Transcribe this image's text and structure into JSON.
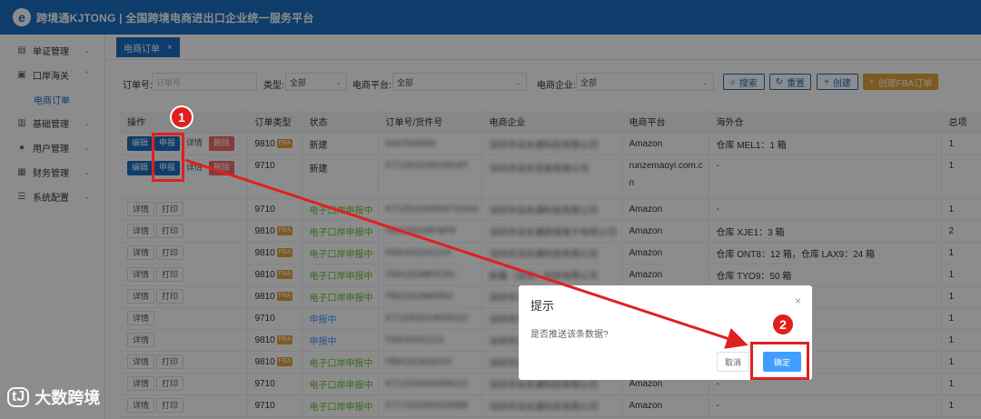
{
  "topbar": {
    "logo": "e",
    "title": "跨境通KJTONG | 全国跨境电商进出口企业统一服务平台"
  },
  "sidebar": {
    "items": [
      {
        "label": "单证管理",
        "icon": "document-icon"
      },
      {
        "label": "口岸海关",
        "icon": "customs-icon"
      },
      {
        "label": "基础管理",
        "icon": "chart-icon"
      },
      {
        "label": "用户管理",
        "icon": "user-icon"
      },
      {
        "label": "财务管理",
        "icon": "finance-icon"
      },
      {
        "label": "系统配置",
        "icon": "list-icon"
      }
    ],
    "subitem": "电商订单"
  },
  "tab": {
    "label": "电商订单",
    "close": "×"
  },
  "filters": {
    "order_no_label": "订单号:",
    "order_no_placeholder": "订单号",
    "type_label": "类型:",
    "type_value": "全部",
    "platform_label": "电商平台:",
    "platform_value": "全部",
    "company_label": "电商企业:",
    "company_value": "全部",
    "search": "搜索",
    "reset": "重置",
    "create": "创建",
    "create_fba": "创建FBA订单"
  },
  "table": {
    "headers": [
      "操作",
      "订单类型",
      "状态",
      "订单号/货件号",
      "电商企业",
      "电商平台",
      "海外仓",
      "总项"
    ],
    "actions": {
      "edit": "编辑",
      "declare": "申报",
      "detail": "详情",
      "delete": "删除",
      "print": "打印"
    },
    "fba_tag": "FBA",
    "rows": [
      {
        "type": "9810",
        "fba": true,
        "status": "新建",
        "order": "5407826000",
        "company": "深圳市深关通科技有限公司",
        "platform": "Amazon",
        "warehouse": "仓库 MEL1：1 箱",
        "total": "1"
      },
      {
        "type": "9710",
        "fba": false,
        "status": "新建",
        "order": "KT1291624019918T",
        "company": "深圳市深关贸易有限公司",
        "platform": "runzemaoyi.com.c",
        "platform2": "n",
        "warehouse": "-",
        "total": "1"
      },
      {
        "type": "9710",
        "fba": false,
        "status": "电子口岸申报中",
        "order": "KT1251532003715244",
        "company": "深圳市深关通科技有限公司",
        "platform": "Amazon",
        "warehouse": "-",
        "total": "1"
      },
      {
        "type": "9810",
        "fba": true,
        "status": "电子口岸申报中",
        "order": "FBA15GZ8FNPR",
        "company": "深圳市深关通跨境电子有限公司",
        "platform": "Amazon",
        "warehouse": "仓库 XJE1：3 箱",
        "total": "2"
      },
      {
        "type": "9810",
        "fba": true,
        "status": "电子口岸申报中",
        "order": "FBA15GZ41124",
        "company": "深圳市深关通科技有限公司",
        "platform": "Amazon",
        "warehouse": "仓库 ONT8：12 箱，仓库 LAX9：24 箱",
        "total": "1"
      },
      {
        "type": "9810",
        "fba": true,
        "status": "电子口岸申报中",
        "order": "FBA15G8BSC6V",
        "company": "新疆（深关）科技有限公司",
        "platform": "Amazon",
        "warehouse": "仓库 TYO9：50 箱",
        "total": "1"
      },
      {
        "type": "9810",
        "fba": true,
        "status": "电子口岸申报中",
        "order": "FBA15G8M0902",
        "company": "深圳市深关通科技有限公司",
        "platform": "Amazon",
        "warehouse": "-",
        "total": "1"
      },
      {
        "type": "9710",
        "fba": false,
        "status": "申报中",
        "order": "KT12303219029122",
        "company": "深圳市深关通科技有限公司",
        "platform": "Amazon",
        "warehouse": "-",
        "total": "1"
      },
      {
        "type": "9810",
        "fba": true,
        "status": "申报中",
        "order": "FBA20251123",
        "company": "深圳市深关通科技有限公司",
        "platform": "Amazon",
        "warehouse": "-",
        "total": "1"
      },
      {
        "type": "9810",
        "fba": true,
        "status": "电子口岸申报中",
        "order": "FBA15G8282S4",
        "company": "深圳市深关通科技有限公司",
        "platform": "Amazon",
        "warehouse": "仓库 SMF3：3 箱",
        "total": "1"
      },
      {
        "type": "9710",
        "fba": false,
        "status": "电子口岸申报中",
        "order": "KT12319402668123",
        "company": "深圳市深关通科技有限公司",
        "platform": "Amazon",
        "warehouse": "-",
        "total": "1"
      },
      {
        "type": "9710",
        "fba": false,
        "status": "电子口岸申报中",
        "order": "KT17022400316688",
        "company": "深圳市深关通科技有限公司",
        "platform": "Amazon",
        "warehouse": "-",
        "total": "1"
      }
    ]
  },
  "dialog": {
    "title": "提示",
    "message": "是否推送该条数据?",
    "cancel": "取消",
    "confirm": "确定",
    "close": "×"
  },
  "markers": {
    "one": "1",
    "two": "2"
  },
  "watermark": {
    "logo": "tJ",
    "text": "大数跨境"
  },
  "colors": {
    "primary": "#1a6fc4",
    "highlight": "#e02020",
    "fba_tag": "#e6a23c",
    "status_green": "#67c23a",
    "status_blue": "#409eff"
  }
}
